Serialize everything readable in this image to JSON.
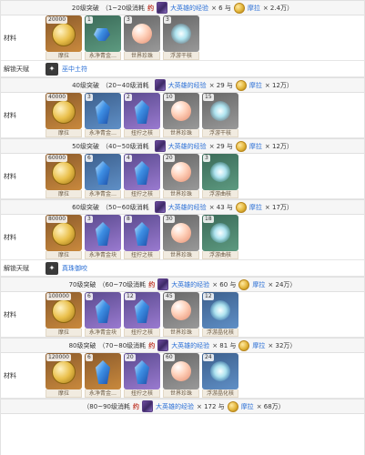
{
  "stages": [
    {
      "level": "20级突破",
      "range": "（1~20级消耗",
      "book_qty": "约",
      "exp_name": "大英雄的经验",
      "exp_count": "× 6 与",
      "mora_name": "摩拉",
      "mora_count": "× 2.4万）",
      "materials_label": "材料",
      "materials": [
        {
          "qty": "20000",
          "name": "摩拉",
          "quality": "q5",
          "glyph": "coin"
        },
        {
          "qty": "1",
          "name": "永净青金…",
          "quality": "q2",
          "glyph": "gem-small"
        },
        {
          "qty": "3",
          "name": "世界珍珠",
          "quality": "q1",
          "glyph": "pearl"
        },
        {
          "qty": "3",
          "name": "浮游干核",
          "quality": "q1",
          "glyph": "flower"
        }
      ]
    },
    {
      "talent_label": "解锁天赋",
      "talent_name": "巫中土符"
    },
    {
      "level": "40级突破",
      "range": "（20~40级消耗",
      "book_qty": "",
      "exp_name": "大英雄的经验",
      "exp_count": "× 29 与",
      "mora_name": "摩拉",
      "mora_count": "× 12万）",
      "materials_label": "材料",
      "materials": [
        {
          "qty": "40000",
          "name": "摩拉",
          "quality": "q5",
          "glyph": "coin"
        },
        {
          "qty": "3",
          "name": "永净青金…",
          "quality": "q3",
          "glyph": "gem"
        },
        {
          "qty": "2",
          "name": "扭拧之核",
          "quality": "q4",
          "glyph": "gem"
        },
        {
          "qty": "10",
          "name": "世界珍珠",
          "quality": "q1",
          "glyph": "pearl"
        },
        {
          "qty": "15",
          "name": "浮游干核",
          "quality": "q1",
          "glyph": "flower"
        }
      ]
    },
    {
      "level": "50级突破",
      "range": "（40~50级消耗",
      "book_qty": "",
      "exp_name": "大英雄的经验",
      "exp_count": "× 29 与",
      "mora_name": "摩拉",
      "mora_count": "× 12万）",
      "materials_label": "材料",
      "materials": [
        {
          "qty": "60000",
          "name": "摩拉",
          "quality": "q5",
          "glyph": "coin"
        },
        {
          "qty": "6",
          "name": "永净青金…",
          "quality": "q3",
          "glyph": "gem"
        },
        {
          "qty": "4",
          "name": "扭拧之核",
          "quality": "q4",
          "glyph": "gem"
        },
        {
          "qty": "20",
          "name": "世界珍珠",
          "quality": "q1",
          "glyph": "pearl"
        },
        {
          "qty": "3",
          "name": "浮游曲核",
          "quality": "q2",
          "glyph": "flower"
        }
      ]
    },
    {
      "level": "60级突破",
      "range": "（50~60级消耗",
      "book_qty": "",
      "exp_name": "大英雄的经验",
      "exp_count": "× 43 与",
      "mora_name": "摩拉",
      "mora_count": "× 17万）",
      "materials_label": "材料",
      "materials": [
        {
          "qty": "80000",
          "name": "摩拉",
          "quality": "q5",
          "glyph": "coin"
        },
        {
          "qty": "3",
          "name": "永净青金块",
          "quality": "q4",
          "glyph": "gem"
        },
        {
          "qty": "8",
          "name": "扭拧之核",
          "quality": "q4",
          "glyph": "gem"
        },
        {
          "qty": "30",
          "name": "世界珍珠",
          "quality": "q1",
          "glyph": "pearl"
        },
        {
          "qty": "18",
          "name": "浮游曲核",
          "quality": "q2",
          "glyph": "flower"
        }
      ]
    },
    {
      "talent_label": "解锁天赋",
      "talent_name": "真珠御咬"
    },
    {
      "level": "70级突破",
      "range": "（60~70级消耗",
      "book_qty": "约",
      "exp_name": "大英雄的经验",
      "exp_count": "× 60 与",
      "mora_name": "摩拉",
      "mora_count": "× 24万）",
      "materials_label": "材料",
      "materials": [
        {
          "qty": "100000",
          "name": "摩拉",
          "quality": "q5",
          "glyph": "coin"
        },
        {
          "qty": "6",
          "name": "永净青金块",
          "quality": "q4",
          "glyph": "gem"
        },
        {
          "qty": "12",
          "name": "扭拧之核",
          "quality": "q4",
          "glyph": "gem"
        },
        {
          "qty": "45",
          "name": "世界珍珠",
          "quality": "q1",
          "glyph": "pearl"
        },
        {
          "qty": "12",
          "name": "浮游晶化核",
          "quality": "q3",
          "glyph": "flower"
        }
      ]
    },
    {
      "level": "80级突破",
      "range": "（70~80级消耗",
      "book_qty": "约",
      "exp_name": "大英雄的经验",
      "exp_count": "× 81 与",
      "mora_name": "摩拉",
      "mora_count": "× 32万）",
      "materials_label": "材料",
      "materials": [
        {
          "qty": "120000",
          "name": "摩拉",
          "quality": "q5",
          "glyph": "coin"
        },
        {
          "qty": "6",
          "name": "永净青金…",
          "quality": "q5",
          "glyph": "gem"
        },
        {
          "qty": "20",
          "name": "扭拧之核",
          "quality": "q4",
          "glyph": "gem"
        },
        {
          "qty": "60",
          "name": "世界珍珠",
          "quality": "q1",
          "glyph": "pearl"
        },
        {
          "qty": "24",
          "name": "浮游晶化核",
          "quality": "q3",
          "glyph": "flower"
        }
      ]
    },
    {
      "level": "",
      "range": "（80~90级消耗",
      "book_qty": "约",
      "exp_name": "大英雄的经验",
      "exp_count": "× 172 与",
      "mora_name": "摩拉",
      "mora_count": "× 68万）",
      "materials_label": "",
      "materials": []
    }
  ]
}
